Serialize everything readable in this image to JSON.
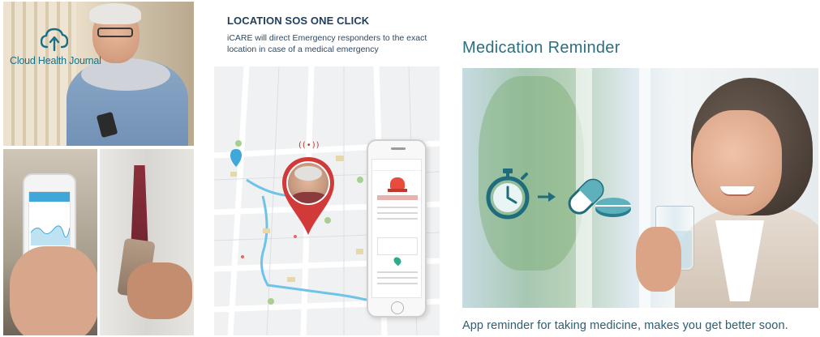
{
  "left_panel": {
    "logo_text": "Cloud Health Journal",
    "logo_icon": "cloud-upload-icon",
    "accent_color": "#1a6f86"
  },
  "sos_section": {
    "title": "LOCATION SOS ONE CLICK",
    "description": "iCARE will direct Emergency responders to the exact location in case of a medical emergency",
    "signal_glyph": "((•))",
    "pin_color": "#d23a3a",
    "title_color": "#1f3d5c"
  },
  "reminder_section": {
    "title": "Medication Reminder",
    "caption": "App reminder for taking medicine, makes you get better soon.",
    "icons": [
      "stopwatch-icon",
      "arrow-right-icon",
      "pills-icon"
    ],
    "accent_color": "#2d6e7e"
  }
}
